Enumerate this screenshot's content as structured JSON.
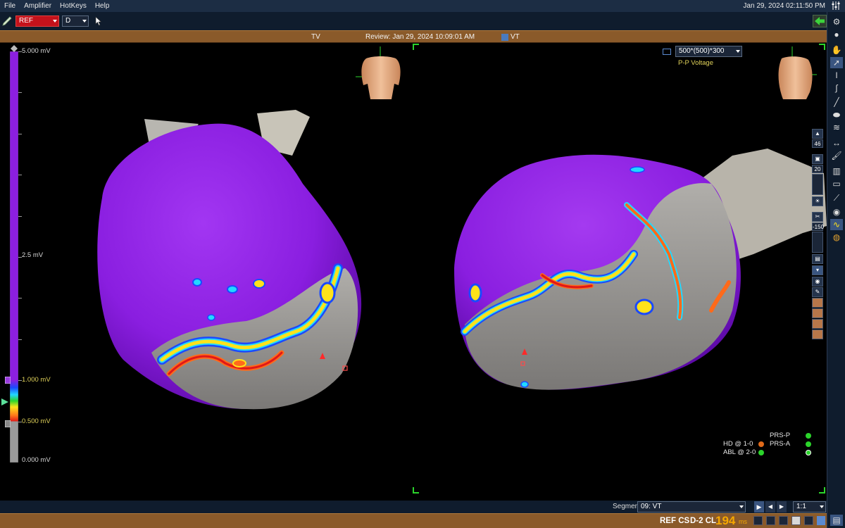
{
  "menu": [
    {
      "label": "File"
    },
    {
      "label": "Amplifier"
    },
    {
      "label": "HotKeys"
    },
    {
      "label": "Help"
    }
  ],
  "datetime": "Jan 29, 2024 02:11:50 PM",
  "toolbar": {
    "ref_select": "REF",
    "d_select": "D"
  },
  "view_header": {
    "left": "TV",
    "center": "Review: Jan 29, 2024 10:09:01 AM",
    "right": "VT"
  },
  "scale": {
    "top": "5.000 mV",
    "mid": "2.5 mV",
    "upper_threshold": "1.000 mV",
    "lower_threshold": "0.500 mV",
    "bottom": "0.000 mV",
    "max_mv": 5.0,
    "upper_mv": 1.0,
    "lower_mv": 0.5
  },
  "measure": {
    "select_value": "500*(500)*300",
    "label": "P-P Voltage"
  },
  "mid_column": {
    "count_top": "46",
    "count_a": "20",
    "count_b": "-150"
  },
  "legend": {
    "prs_p": "PRS-P",
    "hd": "HD @ 1-0",
    "prs_a": "PRS-A",
    "abl": "ABL @ 2-0"
  },
  "segment": {
    "label": "Segment",
    "value": "09: VT",
    "ratio": "1:1"
  },
  "status": {
    "ref": "REF CS",
    "cl": "D-2 CL",
    "value": "194",
    "unit": "ms"
  },
  "colors": {
    "menubar": "#1c2d44",
    "toolbar": "#0f1c2d",
    "header": "#8a5a2a",
    "purple": "#8c1fe0",
    "cl_value": "#f5a800"
  }
}
